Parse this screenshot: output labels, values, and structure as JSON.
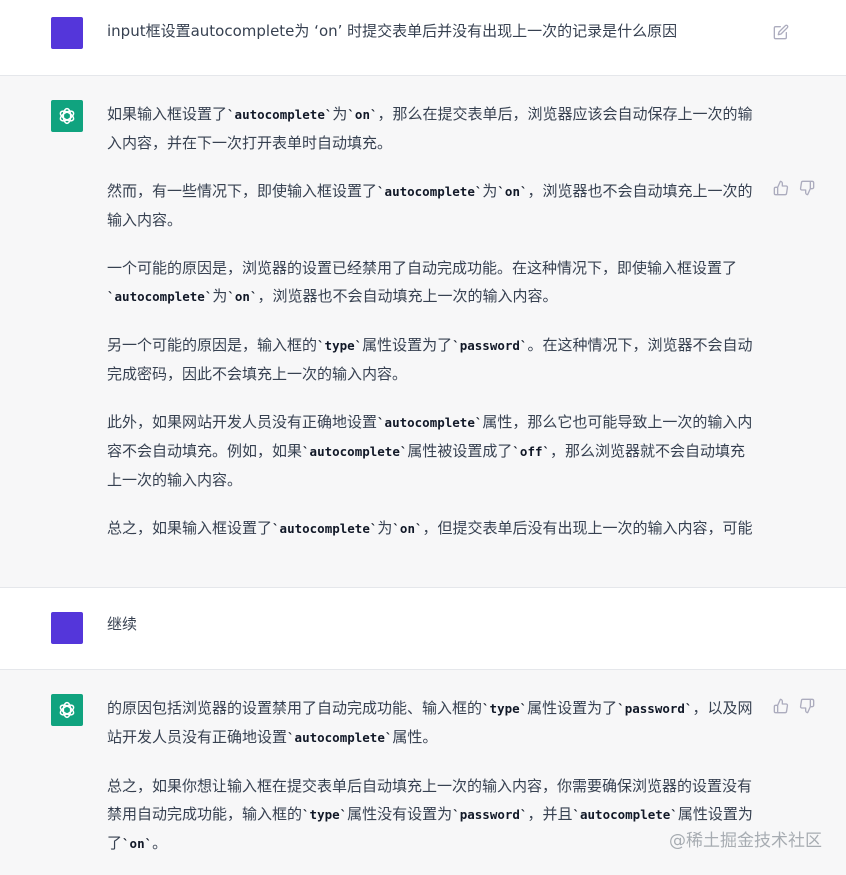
{
  "conversation": [
    {
      "role": "user",
      "text": "input框设置autocomplete为 ‘on’ 时提交表单后并没有出现上一次的记录是什么原因"
    },
    {
      "role": "assistant",
      "paragraphs": [
        [
          [
            "t",
            "如果输入框设置了"
          ],
          [
            "c",
            "`autocomplete`"
          ],
          [
            "t",
            "为"
          ],
          [
            "c",
            "`on`"
          ],
          [
            "t",
            "，那么在提交表单后，浏览器应该会自动保存上一次的输入内容，并在下一次打开表单时自动填充。"
          ]
        ],
        [
          [
            "t",
            "然而，有一些情况下，即使输入框设置了"
          ],
          [
            "c",
            "`autocomplete`"
          ],
          [
            "t",
            "为"
          ],
          [
            "c",
            "`on`"
          ],
          [
            "t",
            "，浏览器也不会自动填充上一次的输入内容。"
          ]
        ],
        [
          [
            "t",
            "一个可能的原因是，浏览器的设置已经禁用了自动完成功能。在这种情况下，即使输入框设置了"
          ],
          [
            "c",
            "`autocomplete`"
          ],
          [
            "t",
            "为"
          ],
          [
            "c",
            "`on`"
          ],
          [
            "t",
            "，浏览器也不会自动填充上一次的输入内容。"
          ]
        ],
        [
          [
            "t",
            "另一个可能的原因是，输入框的"
          ],
          [
            "c",
            "`type`"
          ],
          [
            "t",
            "属性设置为了"
          ],
          [
            "c",
            "`password`"
          ],
          [
            "t",
            "。在这种情况下，浏览器不会自动完成密码，因此不会填充上一次的输入内容。"
          ]
        ],
        [
          [
            "t",
            "此外，如果网站开发人员没有正确地设置"
          ],
          [
            "c",
            "`autocomplete`"
          ],
          [
            "t",
            "属性，那么它也可能导致上一次的输入内容不会自动填充。例如，如果"
          ],
          [
            "c",
            "`autocomplete`"
          ],
          [
            "t",
            "属性被设置成了"
          ],
          [
            "c",
            "`off`"
          ],
          [
            "t",
            "，那么浏览器就不会自动填充上一次的输入内容。"
          ]
        ],
        [
          [
            "t",
            "总之，如果输入框设置了"
          ],
          [
            "c",
            "`autocomplete`"
          ],
          [
            "t",
            "为"
          ],
          [
            "c",
            "`on`"
          ],
          [
            "t",
            "，但提交表单后没有出现上一次的输入内容，可能"
          ]
        ]
      ]
    },
    {
      "role": "user",
      "text": "继续"
    },
    {
      "role": "assistant",
      "paragraphs": [
        [
          [
            "t",
            "的原因包括浏览器的设置禁用了自动完成功能、输入框的"
          ],
          [
            "c",
            "`type`"
          ],
          [
            "t",
            "属性设置为了"
          ],
          [
            "c",
            "`password`"
          ],
          [
            "t",
            "，以及网站开发人员没有正确地设置"
          ],
          [
            "c",
            "`autocomplete`"
          ],
          [
            "t",
            "属性。"
          ]
        ],
        [
          [
            "t",
            "总之，如果你想让输入框在提交表单后自动填充上一次的输入内容，你需要确保浏览器的设置没有禁用自动完成功能，输入框的"
          ],
          [
            "c",
            "`type`"
          ],
          [
            "t",
            "属性没有设置为"
          ],
          [
            "c",
            "`password`"
          ],
          [
            "t",
            "，并且"
          ],
          [
            "c",
            "`autocomplete`"
          ],
          [
            "t",
            "属性设置为了"
          ],
          [
            "c",
            "`on`"
          ],
          [
            "t",
            "。"
          ]
        ]
      ]
    }
  ],
  "icons": {
    "edit": "edit-icon",
    "thumbs_up": "thumbs-up-icon",
    "thumbs_down": "thumbs-down-icon",
    "bot_logo": "openai-logo-icon"
  },
  "colors": {
    "user_avatar": "#5436da",
    "bot_avatar": "#10a37f"
  },
  "watermark": "@稀土掘金技术社区"
}
